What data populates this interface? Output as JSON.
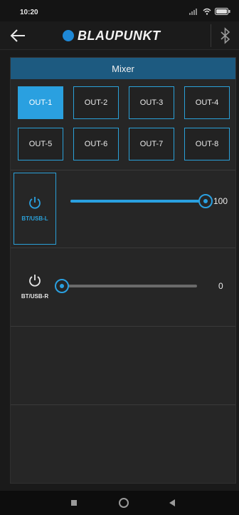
{
  "status": {
    "time": "10:20"
  },
  "header": {
    "brand": "BLAUPUNKT"
  },
  "mixer": {
    "title": "Mixer",
    "outputs": [
      "OUT-1",
      "OUT-2",
      "OUT-3",
      "OUT-4",
      "OUT-5",
      "OUT-6",
      "OUT-7",
      "OUT-8"
    ],
    "selected_output": "OUT-1",
    "channels": [
      {
        "label": "BT/USB-L",
        "value": "100",
        "level": 100,
        "active": true
      },
      {
        "label": "BT/USB-R",
        "value": "0",
        "level": 0,
        "active": false
      }
    ]
  },
  "colors": {
    "accent": "#2aa0e0",
    "header_bg": "#1d5a80",
    "brand_dot": "#1e88d6"
  },
  "icons": {
    "back": "arrow-left-icon",
    "bluetooth": "bluetooth-icon",
    "power": "power-icon",
    "nav_recent": "square-icon",
    "nav_home": "circle-icon",
    "nav_back": "triangle-back-icon"
  }
}
